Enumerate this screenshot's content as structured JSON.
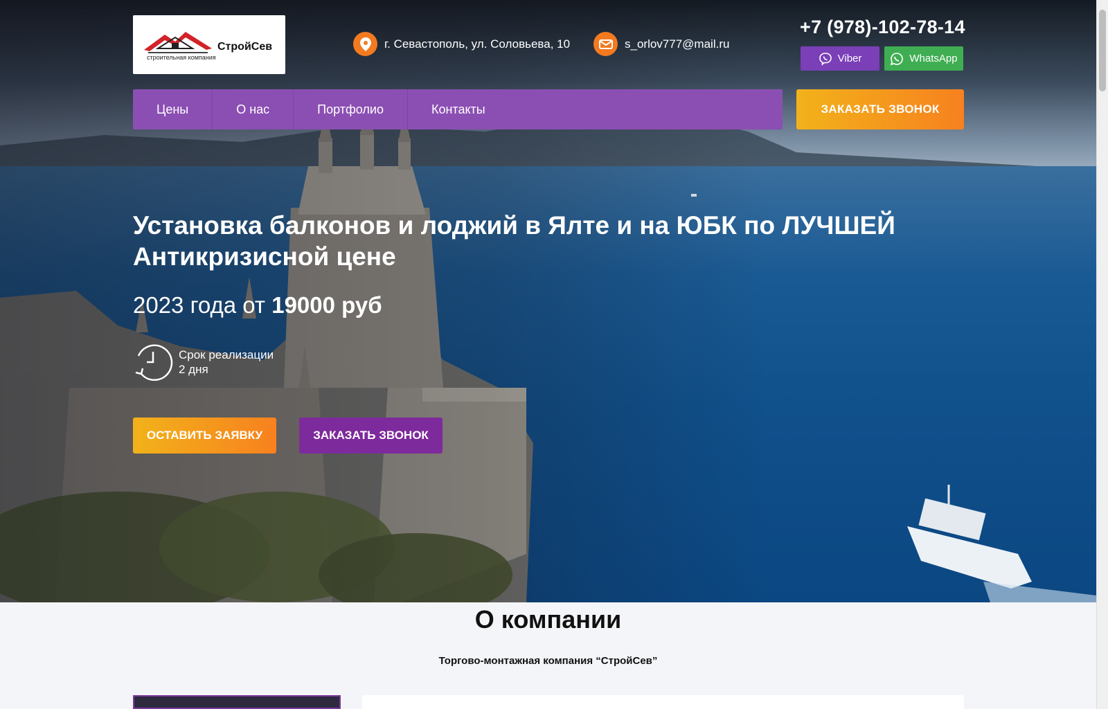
{
  "header": {
    "logo": {
      "brand": "СтройСев",
      "tagline": "строительная компания"
    },
    "address": {
      "text": "г. Севастополь, ул. Соловьева, 10",
      "icon": "location-pin-icon"
    },
    "email": {
      "text": "s_orlov777@mail.ru",
      "icon": "envelope-icon"
    },
    "phone": "+7 (978)-102-78-14",
    "messengers": [
      {
        "label": "Viber",
        "icon": "viber-icon",
        "color": "#7b3fb8"
      },
      {
        "label": "WhatsApp",
        "icon": "whatsapp-icon",
        "color": "#3fae52"
      }
    ]
  },
  "nav": {
    "items": [
      "Цены",
      "О нас",
      "Портфолио",
      "Контакты"
    ],
    "cta": "ЗАКАЗАТЬ ЗВОНОК"
  },
  "hero": {
    "title": "Установка балконов и лоджий в Ялте и на ЮБК по ЛУЧШЕЙ Антикризисной цене",
    "price_prefix": "2023 года от ",
    "price_value": "19000 руб",
    "term_label": "Срок реализации",
    "term_value": "2 дня",
    "term_icon": "clock-icon",
    "buttons": {
      "primary": "ОСТАВИТЬ ЗАЯВКУ",
      "secondary": "ЗАКАЗАТЬ ЗВОНОК"
    }
  },
  "about": {
    "title": "О компании",
    "subtitle": "Торгово-монтажная компания “СтройСев”"
  },
  "colors": {
    "accent_purple": "#8b4fb3",
    "accent_orange": "#f7811f",
    "accent_yellow": "#f2b21a",
    "button_purple": "#7d2a9c"
  }
}
